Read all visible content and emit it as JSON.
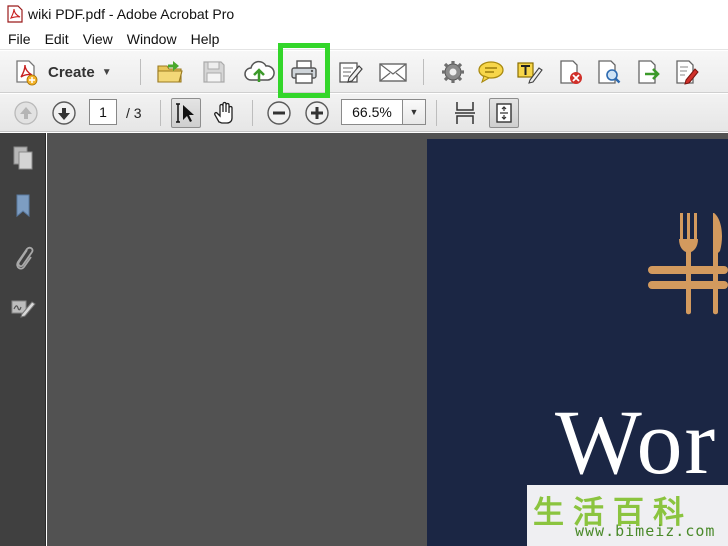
{
  "window": {
    "title": "wiki PDF.pdf - Adobe Acrobat Pro",
    "app_icon": "acrobat-pdf-icon"
  },
  "menu": {
    "items": [
      "File",
      "Edit",
      "View",
      "Window",
      "Help"
    ]
  },
  "toolbar": {
    "create_label": "Create",
    "create_icon": "create-pdf-icon",
    "buttons": [
      "open-folder-icon",
      "save-icon",
      "upload-cloud-icon",
      "print-icon",
      "sign-edit-icon",
      "email-icon",
      "gear-icon",
      "comment-icon",
      "typewriter-icon",
      "delete-pdf-icon",
      "search-pdf-icon",
      "export-icon",
      "form-edit-icon"
    ],
    "highlighted_button": "print-icon",
    "highlight_color": "#33d62a"
  },
  "navigation": {
    "current_page": "1",
    "page_total": "/ 3",
    "zoom": "66.5%"
  },
  "left_panel": {
    "icons": [
      "pages-icon",
      "bookmark-icon",
      "attachment-icon",
      "signature-icon"
    ]
  },
  "document": {
    "page_background": "#1b2644",
    "visible_text": "Wor",
    "logo": "fork-knife-logo",
    "logo_color": "#d39a5e"
  },
  "watermark": {
    "characters": "生活百科",
    "url": "www.bimeiz.com"
  }
}
